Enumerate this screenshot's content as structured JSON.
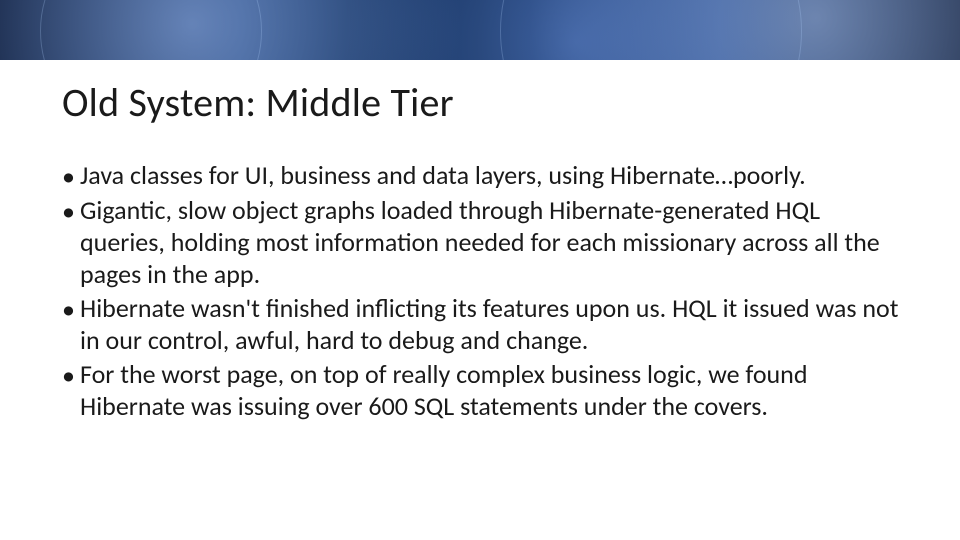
{
  "banner": {
    "alt": "abstract blue fractal banner"
  },
  "title": "Old System: Middle Tier",
  "bullets": [
    "Java classes for UI, business and data layers, using Hibernate…poorly.",
    "Gigantic, slow object graphs loaded through Hibernate-generated HQL queries, holding most information needed for each missionary across all the pages in the app.",
    "Hibernate wasn't finished inflicting its features upon us. HQL it issued was not in our control, awful, hard to debug and change.",
    "For the worst page, on top of really complex business logic, we found Hibernate was issuing over 600 SQL statements under the covers."
  ],
  "bullet_glyph": "•"
}
